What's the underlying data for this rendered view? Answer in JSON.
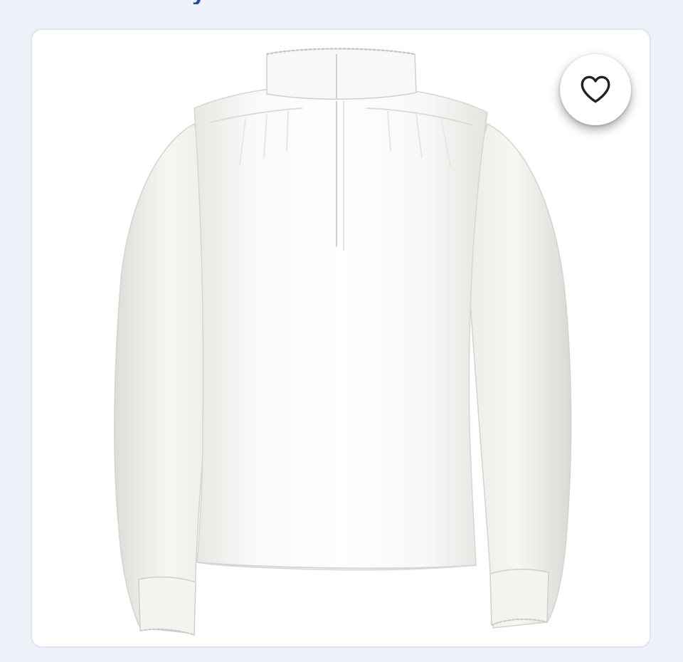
{
  "header": {
    "partial_title_fragment": "y"
  },
  "product": {
    "image_icon": "white-blouse-image",
    "favorite_icon": "heart-outline-icon"
  },
  "colors": {
    "background": "#eef1f7",
    "card": "#ffffff",
    "card_border": "#dfe5ef",
    "title_accent": "#1d4ea3"
  }
}
